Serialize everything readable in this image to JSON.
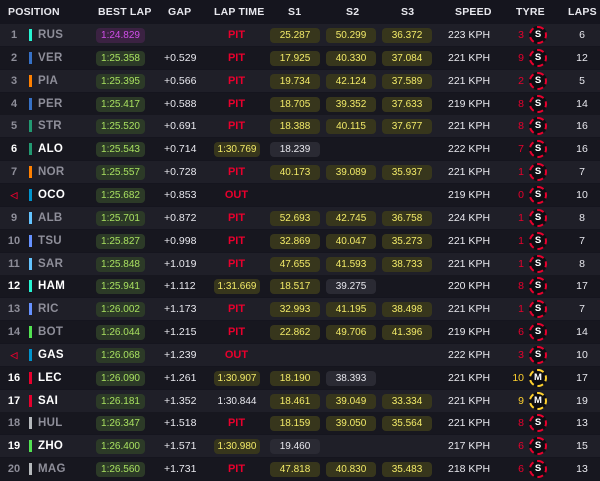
{
  "header": {
    "position": "POSITION",
    "best_lap": "BEST LAP",
    "gap": "GAP",
    "lap_time": "LAP TIME",
    "s1": "S1",
    "s2": "S2",
    "s3": "S3",
    "speed": "SPEED",
    "tyre": "TYRE",
    "laps": "LAPS"
  },
  "colors": {
    "background": "#15151e",
    "pit_red": "#e8002d",
    "personal_best_green": "#a8e060",
    "fastest_purple": "#d04ee8",
    "sector_yellow": "#f2ea68",
    "soft_red": "#e8002d",
    "medium_yellow": "#ffd12e"
  },
  "rows": [
    {
      "pos": "1",
      "pos_white": false,
      "code": "RUS",
      "code_white": false,
      "team": "#27f4d2",
      "best": "1:24.829",
      "best_purple": true,
      "gap": "",
      "status": "PIT",
      "lap_time": "",
      "s1": "25.287",
      "s1_style": "yel",
      "s2": "50.299",
      "s2_style": "yel",
      "s3": "36.372",
      "s3_style": "yel",
      "speed": "223 KPH",
      "tyre_age": "3",
      "tyre_compound": "soft",
      "tyre_letter": "S",
      "laps": "6"
    },
    {
      "pos": "2",
      "pos_white": false,
      "code": "VER",
      "code_white": false,
      "team": "#3671c6",
      "best": "1:25.358",
      "best_purple": false,
      "gap": "+0.529",
      "status": "PIT",
      "lap_time": "",
      "s1": "17.925",
      "s1_style": "yel",
      "s2": "40.330",
      "s2_style": "yel",
      "s3": "37.084",
      "s3_style": "yel",
      "speed": "221 KPH",
      "tyre_age": "9",
      "tyre_compound": "soft",
      "tyre_letter": "S",
      "laps": "12"
    },
    {
      "pos": "3",
      "pos_white": false,
      "code": "PIA",
      "code_white": false,
      "team": "#ff8000",
      "best": "1:25.395",
      "best_purple": false,
      "gap": "+0.566",
      "status": "PIT",
      "lap_time": "",
      "s1": "19.734",
      "s1_style": "yel",
      "s2": "42.124",
      "s2_style": "yel",
      "s3": "37.589",
      "s3_style": "yel",
      "speed": "221 KPH",
      "tyre_age": "2",
      "tyre_compound": "soft",
      "tyre_letter": "S",
      "laps": "5"
    },
    {
      "pos": "4",
      "pos_white": false,
      "code": "PER",
      "code_white": false,
      "team": "#3671c6",
      "best": "1:25.417",
      "best_purple": false,
      "gap": "+0.588",
      "status": "PIT",
      "lap_time": "",
      "s1": "18.705",
      "s1_style": "yel",
      "s2": "39.352",
      "s2_style": "yel",
      "s3": "37.633",
      "s3_style": "yel",
      "speed": "219 KPH",
      "tyre_age": "8",
      "tyre_compound": "soft",
      "tyre_letter": "S",
      "laps": "14"
    },
    {
      "pos": "5",
      "pos_white": false,
      "code": "STR",
      "code_white": false,
      "team": "#229971",
      "best": "1:25.520",
      "best_purple": false,
      "gap": "+0.691",
      "status": "PIT",
      "lap_time": "",
      "s1": "18.388",
      "s1_style": "yel",
      "s2": "40.115",
      "s2_style": "yel",
      "s3": "37.677",
      "s3_style": "yel",
      "speed": "221 KPH",
      "tyre_age": "8",
      "tyre_compound": "soft",
      "tyre_letter": "S",
      "laps": "16"
    },
    {
      "pos": "6",
      "pos_white": true,
      "code": "ALO",
      "code_white": true,
      "team": "#229971",
      "best": "1:25.543",
      "best_purple": false,
      "gap": "+0.714",
      "status": "",
      "lap_time": "1:30.769",
      "lap_style": "pillbg",
      "s1": "18.239",
      "s1_style": "wht",
      "s2": "",
      "s2_style": "",
      "s3": "",
      "s3_style": "",
      "speed": "222 KPH",
      "tyre_age": "7",
      "tyre_compound": "soft",
      "tyre_letter": "S",
      "laps": "16"
    },
    {
      "pos": "7",
      "pos_white": false,
      "code": "NOR",
      "code_white": false,
      "team": "#ff8000",
      "best": "1:25.557",
      "best_purple": false,
      "gap": "+0.728",
      "status": "PIT",
      "lap_time": "",
      "s1": "40.173",
      "s1_style": "yel",
      "s2": "39.089",
      "s2_style": "yel",
      "s3": "35.937",
      "s3_style": "yel",
      "speed": "221 KPH",
      "tyre_age": "1",
      "tyre_compound": "soft",
      "tyre_letter": "S",
      "laps": "7"
    },
    {
      "pos": "◁",
      "pos_out": true,
      "pos_white": false,
      "code": "OCO",
      "code_white": true,
      "team": "#0093cc",
      "best": "1:25.682",
      "best_purple": false,
      "gap": "+0.853",
      "status": "OUT",
      "lap_time": "",
      "s1": "",
      "s1_style": "",
      "s2": "",
      "s2_style": "",
      "s3": "",
      "s3_style": "",
      "speed": "219 KPH",
      "tyre_age": "0",
      "tyre_compound": "soft",
      "tyre_letter": "S",
      "laps": "10"
    },
    {
      "pos": "9",
      "pos_white": false,
      "code": "ALB",
      "code_white": false,
      "team": "#64c4ff",
      "best": "1:25.701",
      "best_purple": false,
      "gap": "+0.872",
      "status": "PIT",
      "lap_time": "",
      "s1": "52.693",
      "s1_style": "yel",
      "s2": "42.745",
      "s2_style": "yel",
      "s3": "36.758",
      "s3_style": "yel",
      "speed": "224 KPH",
      "tyre_age": "1",
      "tyre_compound": "soft",
      "tyre_letter": "S",
      "laps": "8"
    },
    {
      "pos": "10",
      "pos_white": false,
      "code": "TSU",
      "code_white": false,
      "team": "#6692ff",
      "best": "1:25.827",
      "best_purple": false,
      "gap": "+0.998",
      "status": "PIT",
      "lap_time": "",
      "s1": "32.869",
      "s1_style": "yel",
      "s2": "40.047",
      "s2_style": "yel",
      "s3": "35.273",
      "s3_style": "yel",
      "speed": "221 KPH",
      "tyre_age": "1",
      "tyre_compound": "soft",
      "tyre_letter": "S",
      "laps": "7"
    },
    {
      "pos": "11",
      "pos_white": false,
      "code": "SAR",
      "code_white": false,
      "team": "#64c4ff",
      "best": "1:25.848",
      "best_purple": false,
      "gap": "+1.019",
      "status": "PIT",
      "lap_time": "",
      "s1": "47.655",
      "s1_style": "yel",
      "s2": "41.593",
      "s2_style": "yel",
      "s3": "38.733",
      "s3_style": "yel",
      "speed": "221 KPH",
      "tyre_age": "1",
      "tyre_compound": "soft",
      "tyre_letter": "S",
      "laps": "8"
    },
    {
      "pos": "12",
      "pos_white": true,
      "code": "HAM",
      "code_white": true,
      "team": "#27f4d2",
      "best": "1:25.941",
      "best_purple": false,
      "gap": "+1.112",
      "status": "",
      "lap_time": "1:31.669",
      "lap_style": "pillbg",
      "s1": "18.517",
      "s1_style": "yel",
      "s2": "39.275",
      "s2_style": "wht",
      "s3": "",
      "s3_style": "",
      "speed": "220 KPH",
      "tyre_age": "8",
      "tyre_compound": "soft",
      "tyre_letter": "S",
      "laps": "17"
    },
    {
      "pos": "13",
      "pos_white": false,
      "code": "RIC",
      "code_white": false,
      "team": "#6692ff",
      "best": "1:26.002",
      "best_purple": false,
      "gap": "+1.173",
      "status": "PIT",
      "lap_time": "",
      "s1": "32.993",
      "s1_style": "yel",
      "s2": "41.195",
      "s2_style": "yel",
      "s3": "38.498",
      "s3_style": "yel",
      "speed": "221 KPH",
      "tyre_age": "1",
      "tyre_compound": "soft",
      "tyre_letter": "S",
      "laps": "7"
    },
    {
      "pos": "14",
      "pos_white": false,
      "code": "BOT",
      "code_white": false,
      "team": "#52e252",
      "best": "1:26.044",
      "best_purple": false,
      "gap": "+1.215",
      "status": "PIT",
      "lap_time": "",
      "s1": "22.862",
      "s1_style": "yel",
      "s2": "49.706",
      "s2_style": "yel",
      "s3": "41.396",
      "s3_style": "yel",
      "speed": "219 KPH",
      "tyre_age": "6",
      "tyre_compound": "soft",
      "tyre_letter": "S",
      "laps": "14"
    },
    {
      "pos": "◁",
      "pos_out": true,
      "pos_white": false,
      "code": "GAS",
      "code_white": true,
      "team": "#0093cc",
      "best": "1:26.068",
      "best_purple": false,
      "gap": "+1.239",
      "status": "OUT",
      "lap_time": "",
      "s1": "",
      "s1_style": "",
      "s2": "",
      "s2_style": "",
      "s3": "",
      "s3_style": "",
      "speed": "222 KPH",
      "tyre_age": "3",
      "tyre_compound": "soft",
      "tyre_letter": "S",
      "laps": "10"
    },
    {
      "pos": "16",
      "pos_white": true,
      "code": "LEC",
      "code_white": true,
      "team": "#e8002d",
      "best": "1:26.090",
      "best_purple": false,
      "gap": "+1.261",
      "status": "",
      "lap_time": "1:30.907",
      "lap_style": "pillbg",
      "s1": "18.190",
      "s1_style": "yel",
      "s2": "38.393",
      "s2_style": "wht",
      "s3": "",
      "s3_style": "",
      "speed": "221 KPH",
      "tyre_age": "10",
      "tyre_compound": "medium",
      "tyre_letter": "M",
      "laps": "17"
    },
    {
      "pos": "17",
      "pos_white": true,
      "code": "SAI",
      "code_white": true,
      "team": "#e8002d",
      "best": "1:26.181",
      "best_purple": false,
      "gap": "+1.352",
      "status": "",
      "lap_time": "1:30.844",
      "lap_style": "plain",
      "s1": "18.461",
      "s1_style": "yel",
      "s2": "39.049",
      "s2_style": "yel",
      "s3": "33.334",
      "s3_style": "yel",
      "speed": "221 KPH",
      "tyre_age": "9",
      "tyre_compound": "medium",
      "tyre_letter": "M",
      "laps": "19"
    },
    {
      "pos": "18",
      "pos_white": false,
      "code": "HUL",
      "code_white": false,
      "team": "#b6babd",
      "best": "1:26.347",
      "best_purple": false,
      "gap": "+1.518",
      "status": "PIT",
      "lap_time": "",
      "s1": "18.159",
      "s1_style": "yel",
      "s2": "39.050",
      "s2_style": "yel",
      "s3": "35.564",
      "s3_style": "yel",
      "speed": "221 KPH",
      "tyre_age": "8",
      "tyre_compound": "soft",
      "tyre_letter": "S",
      "laps": "13"
    },
    {
      "pos": "19",
      "pos_white": true,
      "code": "ZHO",
      "code_white": true,
      "team": "#52e252",
      "best": "1:26.400",
      "best_purple": false,
      "gap": "+1.571",
      "status": "",
      "lap_time": "1:30.980",
      "lap_style": "pillbg",
      "s1": "19.460",
      "s1_style": "wht",
      "s2": "",
      "s2_style": "",
      "s3": "",
      "s3_style": "",
      "speed": "217 KPH",
      "tyre_age": "6",
      "tyre_compound": "soft",
      "tyre_letter": "S",
      "laps": "15"
    },
    {
      "pos": "20",
      "pos_white": false,
      "code": "MAG",
      "code_white": false,
      "team": "#b6babd",
      "best": "1:26.560",
      "best_purple": false,
      "gap": "+1.731",
      "status": "PIT",
      "lap_time": "",
      "s1": "47.818",
      "s1_style": "yel",
      "s2": "40.830",
      "s3": "35.483",
      "s2_style": "yel",
      "s3_style": "yel",
      "speed": "218 KPH",
      "tyre_age": "6",
      "tyre_compound": "soft",
      "tyre_letter": "S",
      "laps": "13"
    }
  ]
}
